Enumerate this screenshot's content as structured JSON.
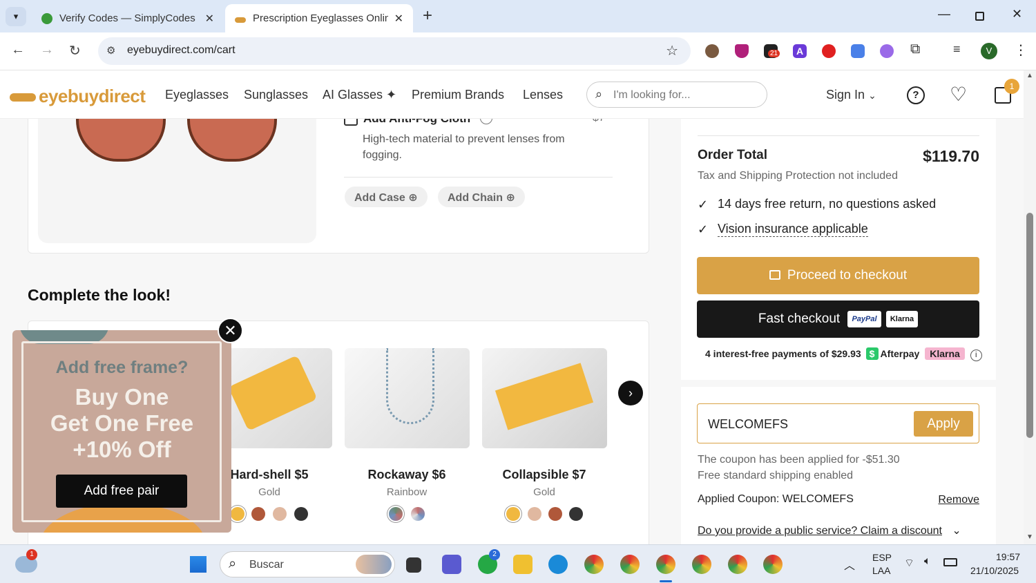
{
  "browser": {
    "tabs": [
      {
        "title": "Verify Codes — SimplyCodes",
        "active": false
      },
      {
        "title": "Prescription Eyeglasses Online |",
        "active": true
      }
    ],
    "url": "eyebuydirect.com/cart",
    "profile_initial": "V",
    "ext_badge": "21"
  },
  "site": {
    "logo": "eyebuydirect",
    "nav": [
      "Eyeglasses",
      "Sunglasses",
      "AI Glasses ✦",
      "Premium Brands",
      "Lenses"
    ],
    "search_placeholder": "I'm looking for...",
    "sign_in": "Sign In",
    "cart_count": "1"
  },
  "cart_item": {
    "addon_title": "Add Anti-Fog Cloth",
    "addon_price": "$7",
    "addon_desc": "High-tech material to prevent lenses from fogging.",
    "add_case": "Add Case",
    "add_chain": "Add Chain"
  },
  "complete_look": {
    "title": "Complete the look!",
    "products": [
      {
        "name": "Hard-shell $5",
        "color": "Gold",
        "swatches": [
          "#f0b840",
          "#b0583a",
          "#e0b8a0",
          "#333333"
        ]
      },
      {
        "name": "Rockaway $6",
        "color": "Rainbow",
        "swatches": [
          "#6a8a70",
          "#c07070"
        ]
      },
      {
        "name": "Collapsible $7",
        "color": "Gold",
        "swatches": [
          "#f0b840",
          "#e0b8a0",
          "#b0583a",
          "#333333"
        ]
      }
    ]
  },
  "popup": {
    "heading": "Add free frame?",
    "line1": "Buy One",
    "line2": "Get One Free",
    "line3": "+10% Off",
    "button": "Add free pair"
  },
  "order": {
    "total_label": "Order Total",
    "total_value": "$119.70",
    "tax_note": "Tax and Shipping Protection not included",
    "perks": [
      "14 days free return, no questions asked",
      "Vision insurance applicable"
    ],
    "checkout": "Proceed to checkout",
    "fast_checkout": "Fast checkout",
    "paypal": "PayPal",
    "klarna": "Klarna",
    "installments": "4 interest-free payments of $29.93",
    "afterpay": "Afterpay",
    "coupon_value": "WELCOMEFS",
    "apply": "Apply",
    "coupon_msg1": "The coupon has been applied for -$51.30",
    "coupon_msg2": "Free standard shipping enabled",
    "applied_label": "Applied Coupon: WELCOMEFS",
    "remove": "Remove",
    "public_service": "Do you provide a public service? Claim a discount"
  },
  "taskbar": {
    "search": "Buscar",
    "lang1": "ESP",
    "lang2": "LAA",
    "time": "19:57",
    "date": "21/10/2025",
    "weather_badge": "1",
    "whatsapp_badge": "2"
  }
}
